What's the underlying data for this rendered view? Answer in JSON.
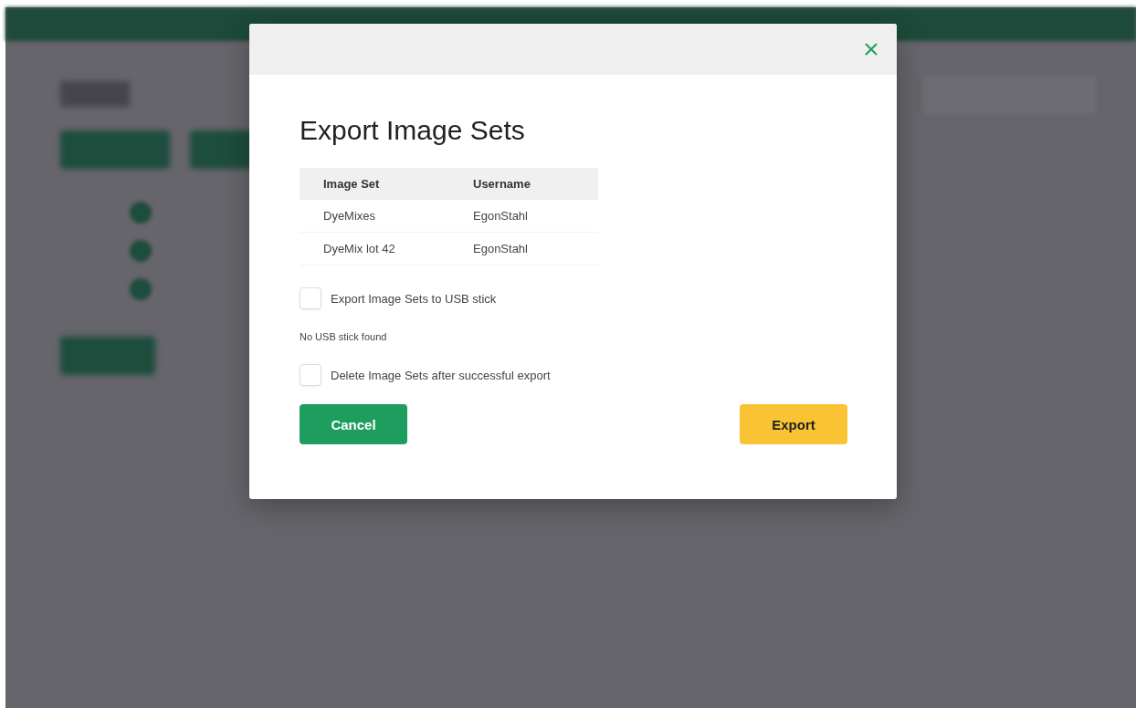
{
  "dialog": {
    "title": "Export Image Sets",
    "table": {
      "columns": [
        "Image Set",
        "Username"
      ],
      "rows": [
        [
          "DyeMixes",
          "EgonStahl"
        ],
        [
          "DyeMix lot 42",
          "EgonStahl"
        ]
      ]
    },
    "options": [
      {
        "label": "Export Image Sets to USB stick",
        "checked": false,
        "note": "No USB stick found"
      },
      {
        "label": "Delete Image Sets after successful export",
        "checked": false
      }
    ],
    "buttons": [
      {
        "label": "Cancel",
        "kind": "secondary"
      },
      {
        "label": "Export",
        "kind": "primary"
      }
    ]
  }
}
